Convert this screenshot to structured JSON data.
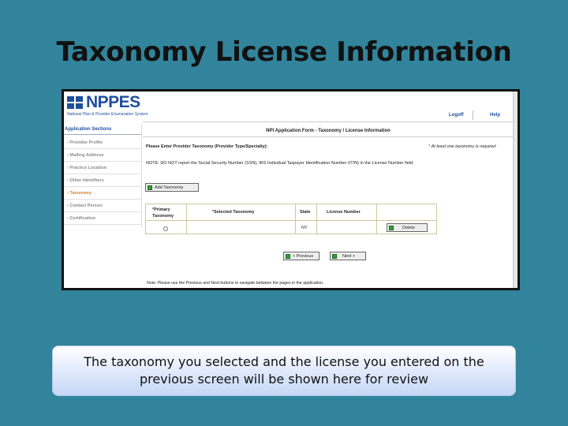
{
  "slide": {
    "title": "Taxonomy License Information",
    "caption": "The taxonomy you selected and the license you entered on the previous screen will be shown here for review"
  },
  "app": {
    "logo_text": "NPPES",
    "logo_subtitle": "National Plan & Provider Enumeration System",
    "links": {
      "logoff": "Logoff",
      "help": "Help"
    }
  },
  "sidebar": {
    "title": "Application Sections",
    "items": [
      {
        "label": "› Provider Profile",
        "active": false
      },
      {
        "label": "› Mailing Address",
        "active": false
      },
      {
        "label": "› Practice Location",
        "active": false
      },
      {
        "label": "› Other Identifiers",
        "active": false
      },
      {
        "label": "› Taxonomy",
        "active": true
      },
      {
        "label": "› Contact Person",
        "active": false
      },
      {
        "label": "› Certification",
        "active": false
      }
    ]
  },
  "form": {
    "title": "NPI Application Form - Taxonomy / License Information",
    "instruction": "Please Enter Provider Taxonomy (Provider Type/Specialty):",
    "required_note": "At least one taxonomy is required",
    "ssn_note": "NOTE: DO NOT report the Social Security Number (SSN), IRS Individual Taxpayer Identification Number (ITIN) in the License Number field.",
    "add_button": "Add Taxonomy",
    "table": {
      "headers": {
        "primary_line1": "Primary",
        "primary_line2": "Taxonomy",
        "selected": "Selected Taxonomy",
        "state": "State",
        "license": "License Number"
      },
      "row": {
        "selected_taxonomy": "",
        "state": "NY",
        "license_number": "",
        "delete_label": "Delete"
      }
    },
    "prev_button": "< Previous",
    "next_button": "Next >",
    "bottom_note": "Note: Please use the Previous and Next buttons to navigate between the pages in the application."
  },
  "colors": {
    "slide_background": "#31849b",
    "brand": "#1f4e9e",
    "active_section": "#e07b22",
    "required": "#cc0000"
  }
}
